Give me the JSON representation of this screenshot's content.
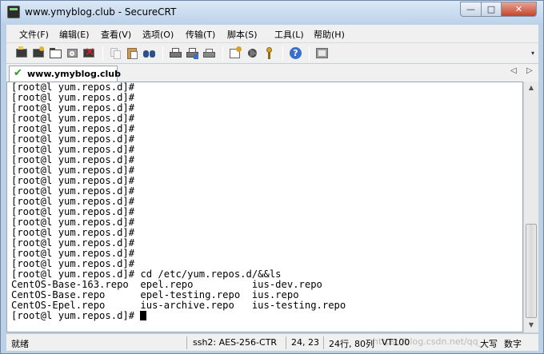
{
  "window": {
    "title": "www.ymyblog.club - SecureCRT",
    "min_glyph": "—",
    "max_glyph": "□",
    "close_glyph": "✕"
  },
  "menu": {
    "items": [
      {
        "label": "文件(F)"
      },
      {
        "label": "编辑(E)"
      },
      {
        "label": "查看(V)"
      },
      {
        "label": "选项(O)"
      },
      {
        "label": "传输(T)"
      },
      {
        "label": "脚本(S)"
      },
      {
        "label": "工具(L)"
      },
      {
        "label": "帮助(H)"
      }
    ]
  },
  "toolbar": {
    "icons": [
      "connect-icon",
      "quick-connect-icon",
      "connect-in-tab-icon",
      "reconnect-icon",
      "disconnect-icon",
      "copy-icon",
      "paste-icon",
      "find-icon",
      "print-icon",
      "print-setup-icon",
      "print-icon-2",
      "session-options-icon",
      "global-options-icon",
      "keymap-icon",
      "help-icon",
      "sftp-icon"
    ],
    "dropdown_glyph": "▾"
  },
  "tabs": {
    "active": {
      "label": "www.ymyblog.club",
      "status_glyph": "✔"
    },
    "prev_glyph": "◁",
    "next_glyph": "▷"
  },
  "terminal": {
    "lines": [
      "[root@l yum.repos.d]#",
      "[root@l yum.repos.d]#",
      "[root@l yum.repos.d]#",
      "[root@l yum.repos.d]#",
      "[root@l yum.repos.d]#",
      "[root@l yum.repos.d]#",
      "[root@l yum.repos.d]#",
      "[root@l yum.repos.d]#",
      "[root@l yum.repos.d]#",
      "[root@l yum.repos.d]#",
      "[root@l yum.repos.d]#",
      "[root@l yum.repos.d]#",
      "[root@l yum.repos.d]#",
      "[root@l yum.repos.d]#",
      "[root@l yum.repos.d]#",
      "[root@l yum.repos.d]#",
      "[root@l yum.repos.d]#",
      "[root@l yum.repos.d]#",
      "[root@l yum.repos.d]# cd /etc/yum.repos.d/&&ls",
      "CentOS-Base-163.repo  epel.repo          ius-dev.repo",
      "CentOS-Base.repo      epel-testing.repo  ius.repo",
      "CentOS-Epel.repo      ius-archive.repo   ius-testing.repo"
    ],
    "prompt": "[root@l yum.repos.d]# "
  },
  "scrollbar": {
    "up_glyph": "▲",
    "down_glyph": "▼"
  },
  "status": {
    "state": "就绪",
    "cipher": "ssh2: AES-256-CTR",
    "cursor_pos": "24,  23",
    "size": "24行, 80列",
    "term": "VT100",
    "caps": "大写",
    "num": "数字",
    "watermark": "https://blog.csdn.net/qq_"
  }
}
